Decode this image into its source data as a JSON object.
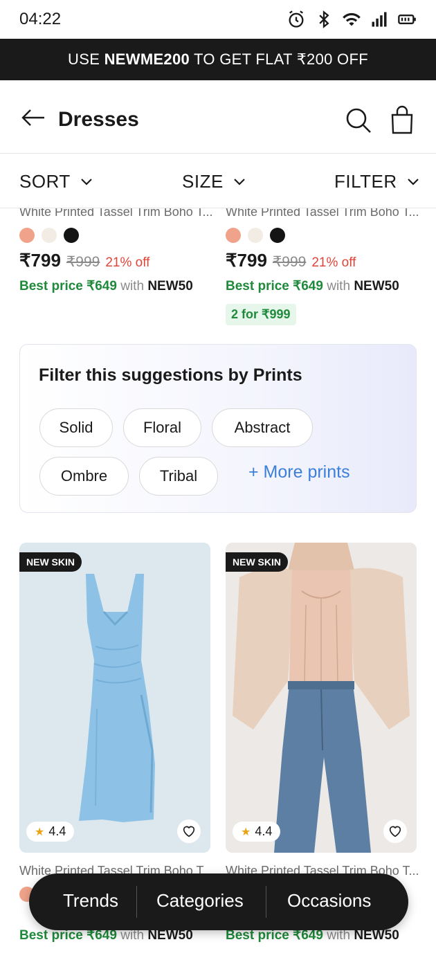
{
  "status_bar": {
    "time": "04:22"
  },
  "promo": {
    "prefix": "USE ",
    "code": "NEWME200",
    "suffix": " TO GET FLAT ₹200 OFF"
  },
  "header": {
    "title": "Dresses"
  },
  "sort_bar": {
    "sort": "SORT",
    "size": "SIZE",
    "filter": "FILTER"
  },
  "top_products": [
    {
      "name": "White Printed Tassel Trim Boho T...",
      "swatches": [
        "#f0a38a",
        "#f3ece4",
        "#141414"
      ],
      "price": "₹799",
      "mrp": "₹999",
      "off": "21% off",
      "best_label": "Best price ₹649",
      "best_with": " with ",
      "best_code": "NEW50"
    },
    {
      "name": "White Printed Tassel Trim Boho T...",
      "swatches": [
        "#f0a38a",
        "#f3ece4",
        "#141414"
      ],
      "price": "₹799",
      "mrp": "₹999",
      "off": "21% off",
      "best_label": "Best price ₹649",
      "best_with": " with ",
      "best_code": "NEW50",
      "combo": "2 for ₹999"
    }
  ],
  "filter_suggestion": {
    "title": "Filter this suggestions by Prints",
    "chips": [
      "Solid",
      "Floral",
      "Abstract",
      "Ombre",
      "Tribal"
    ],
    "more": "+ More prints"
  },
  "products": [
    {
      "tag": "NEW SKIN",
      "rating": "4.4",
      "name": "White Printed Tassel Trim Boho T...",
      "best_label": "Best price ₹649",
      "best_with": " with ",
      "best_code": "NEW50"
    },
    {
      "tag": "NEW SKIN",
      "rating": "4.4",
      "name": "White Printed Tassel Trim Boho T...",
      "best_label": "Best price ₹649",
      "best_with": " with ",
      "best_code": "NEW50"
    }
  ],
  "bottom_nav": {
    "trends": "Trends",
    "categories": "Categories",
    "occasions": "Occasions"
  },
  "colors": {
    "accent_green": "#1f8a3b",
    "discount_red": "#e0453a",
    "link_blue": "#3b7fd8",
    "dark": "#1a1a1a"
  }
}
